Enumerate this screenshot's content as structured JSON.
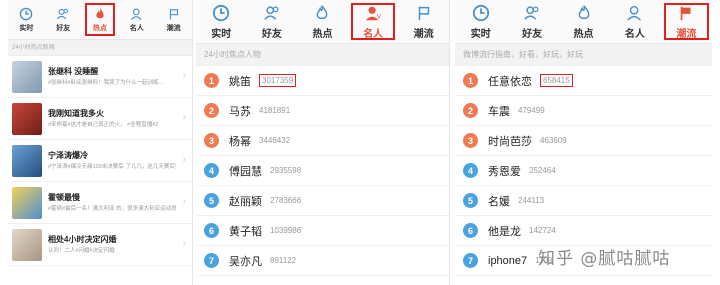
{
  "colors": {
    "accent": "#e5533d",
    "highlight_box": "#e02020"
  },
  "panel1": {
    "tabs": [
      {
        "label": "实时",
        "icon": "clock-icon"
      },
      {
        "label": "好友",
        "icon": "friends-icon"
      },
      {
        "label": "热点",
        "icon": "flame-icon"
      },
      {
        "label": "名人",
        "icon": "celebrity-icon"
      },
      {
        "label": "潮流",
        "icon": "flag-icon"
      }
    ],
    "subheader": "24小时热点新闻",
    "items": [
      {
        "title": "张继科 没睡醒",
        "desc": "#张继科#卧底张继科！我哭了为什么一起训练...",
        "thumb": "#a3b6c9"
      },
      {
        "title": "我刚知道我多火",
        "desc": "#宋仲基#这才是自己真正的火，\n#全程直播#2",
        "thumb": "#9b3a2a"
      },
      {
        "title": "宁泽涛爆冷",
        "desc": "#宁泽涛#爆冷无缘100米决赛后\n了几几，这几天赛后第一次采访",
        "thumb": "#3f6fa6"
      },
      {
        "title": "霍顿最慢",
        "desc": "#霍顿#最后一名！澳大利亚\n的，很多澳大利亚运动员",
        "thumb": "#d9b43a"
      },
      {
        "title": "相处4小时决定闪婚",
        "desc": "认同！二人#闪婚#决定闪婚",
        "thumb": "#c9b9a8"
      }
    ]
  },
  "panel2": {
    "tabs": [
      {
        "label": "实时",
        "icon": "clock-icon"
      },
      {
        "label": "好友",
        "icon": "friends-icon"
      },
      {
        "label": "热点",
        "icon": "flame-icon"
      },
      {
        "label": "名人",
        "icon": "celebrity-icon"
      },
      {
        "label": "潮流",
        "icon": "flag-icon"
      }
    ],
    "subheader": "24小时焦点人物",
    "items": [
      {
        "rank": "1",
        "name": "姚笛",
        "count": "3017359",
        "color": "#f07b52"
      },
      {
        "rank": "2",
        "name": "马苏",
        "count": "4181891",
        "color": "#f07b52"
      },
      {
        "rank": "3",
        "name": "杨幂",
        "count": "3446432",
        "color": "#f07b52"
      },
      {
        "rank": "4",
        "name": "傅园慧",
        "count": "2935598",
        "color": "#4aa3df"
      },
      {
        "rank": "5",
        "name": "赵丽颖",
        "count": "2783666",
        "color": "#4aa3df"
      },
      {
        "rank": "6",
        "name": "黄子韬",
        "count": "1039986",
        "color": "#4aa3df"
      },
      {
        "rank": "7",
        "name": "吴亦凡",
        "count": "891122",
        "color": "#4aa3df"
      }
    ]
  },
  "panel3": {
    "tabs": [
      {
        "label": "实时",
        "icon": "clock-icon"
      },
      {
        "label": "好友",
        "icon": "friends-icon"
      },
      {
        "label": "热点",
        "icon": "flame-icon"
      },
      {
        "label": "名人",
        "icon": "celebrity-icon"
      },
      {
        "label": "潮流",
        "icon": "flag-icon"
      }
    ],
    "subheader": "微博流行指南，好看，好玩，好玩",
    "items": [
      {
        "rank": "1",
        "name": "任意依恋",
        "count": "658415",
        "color": "#f07b52"
      },
      {
        "rank": "2",
        "name": "车震",
        "count": "479499",
        "color": "#f07b52"
      },
      {
        "rank": "3",
        "name": "时尚芭莎",
        "count": "463609",
        "color": "#f07b52"
      },
      {
        "rank": "4",
        "name": "秀恩爱",
        "count": "252464",
        "color": "#4aa3df"
      },
      {
        "rank": "5",
        "name": "名媛",
        "count": "244113",
        "color": "#4aa3df"
      },
      {
        "rank": "6",
        "name": "他是龙",
        "count": "142724",
        "color": "#4aa3df"
      },
      {
        "rank": "7",
        "name": "iphone7",
        "count": "1109",
        "color": "#4aa3df"
      }
    ]
  },
  "watermark": "知乎 @腻咕腻咕"
}
